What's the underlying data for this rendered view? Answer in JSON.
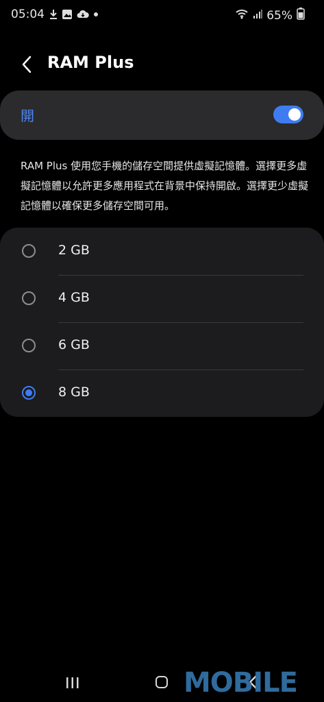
{
  "status_bar": {
    "time": "05:04",
    "battery": "65%",
    "icons": [
      "download-icon",
      "image-icon",
      "cloud-icon",
      "dot-icon",
      "wifi-icon",
      "signal-icon",
      "battery-icon"
    ]
  },
  "header": {
    "title": "RAM Plus",
    "back_icon": "chevron-left-icon"
  },
  "toggle": {
    "label": "開",
    "state": "on",
    "accent": "#3f7cf2"
  },
  "description": "RAM Plus 使用您手機的儲存空間提供虛擬記憶體。選擇更多虛擬記憶體以允許更多應用程式在背景中保持開啟。選擇更少虛擬記憶體以確保更多儲存空間可用。",
  "options": [
    {
      "label": "2 GB",
      "selected": false
    },
    {
      "label": "4 GB",
      "selected": false
    },
    {
      "label": "6 GB",
      "selected": false
    },
    {
      "label": "8 GB",
      "selected": true
    }
  ],
  "nav_bar": {
    "icons": [
      "recents-icon",
      "home-icon",
      "back-icon"
    ]
  },
  "watermark": "MOBILE"
}
